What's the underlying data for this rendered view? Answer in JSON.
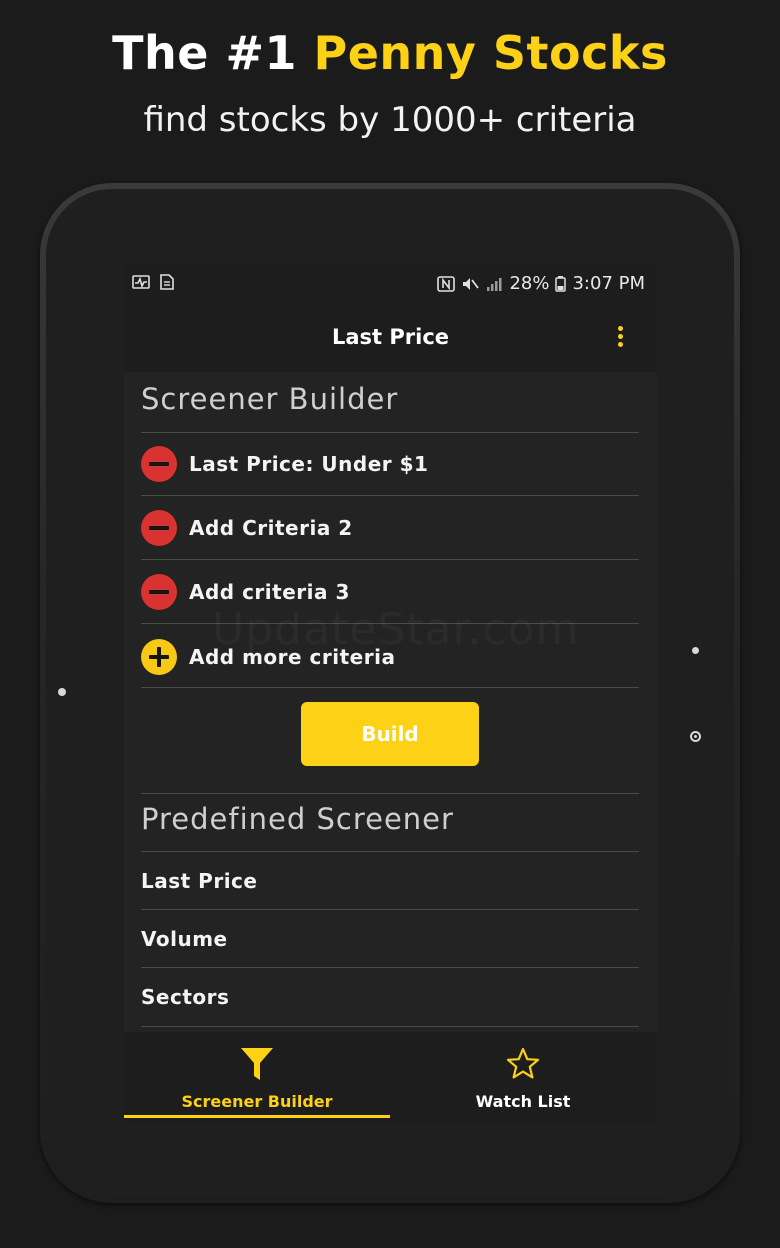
{
  "hero": {
    "title_prefix": "The #1 ",
    "title_accent": "Penny Stocks",
    "subtitle": "find stocks by 1000+ criteria"
  },
  "statusbar": {
    "left_icons": [
      "activity-icon",
      "sim-card-icon"
    ],
    "right_icons": [
      "nfc-icon",
      "mute-icon",
      "signal-icon",
      "battery-icon"
    ],
    "battery": "28%",
    "time": "3:07 PM"
  },
  "appbar": {
    "title": "Last Price",
    "menu_icon": "more-vert-icon"
  },
  "screener_builder": {
    "title": "Screener Builder",
    "criteria": [
      {
        "label": "Last Price: Under $1",
        "action": "remove"
      },
      {
        "label": "Add Criteria 2",
        "action": "remove"
      },
      {
        "label": "Add criteria 3",
        "action": "remove"
      }
    ],
    "add_more_label": "Add more criteria",
    "build_label": "Build"
  },
  "predefined": {
    "title": "Predefined Screener",
    "items": [
      "Last Price",
      "Volume",
      "Sectors"
    ]
  },
  "bottom_nav": {
    "items": [
      {
        "label": "Screener Builder",
        "icon": "filter-icon",
        "active": true
      },
      {
        "label": "Watch List",
        "icon": "star-icon",
        "active": false
      }
    ]
  },
  "watermark": "UpdateStar.com",
  "colors": {
    "accent": "#fcd116",
    "remove": "#d93331",
    "background": "#1b1b1b"
  }
}
